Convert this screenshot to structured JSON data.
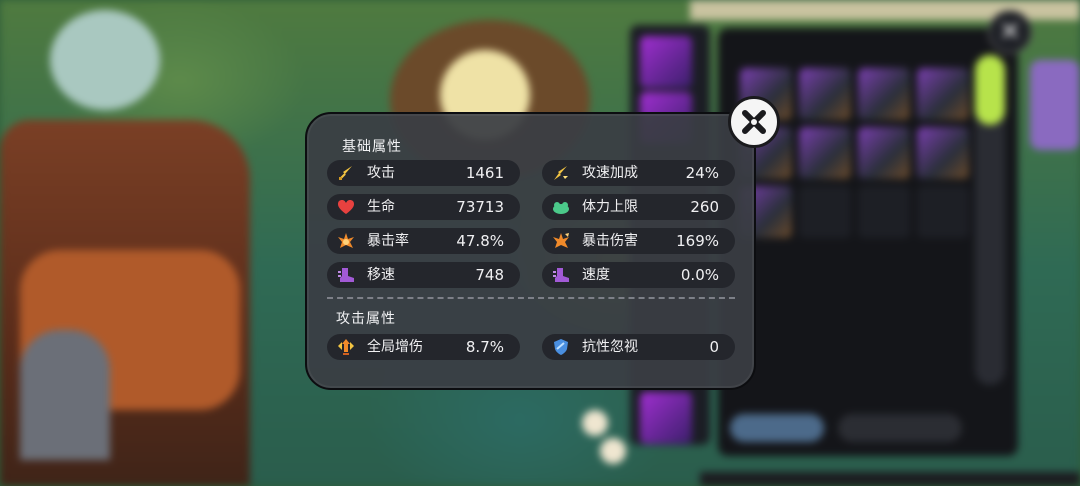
{
  "panel": {
    "basic_title": "基础属性",
    "attack_title": "攻击属性",
    "basic_stats": [
      {
        "name": "攻击",
        "value": "1461",
        "icon": "sword-icon"
      },
      {
        "name": "攻速加成",
        "value": "24%",
        "icon": "attack-speed-icon"
      },
      {
        "name": "生命",
        "value": "73713",
        "icon": "heart-icon"
      },
      {
        "name": "体力上限",
        "value": "260",
        "icon": "stamina-icon"
      },
      {
        "name": "暴击率",
        "value": "47.8%",
        "icon": "crit-rate-icon"
      },
      {
        "name": "暴击伤害",
        "value": "169%",
        "icon": "crit-damage-icon"
      },
      {
        "name": "移速",
        "value": "748",
        "icon": "boot-icon"
      },
      {
        "name": "速度",
        "value": "0.0%",
        "icon": "boot-icon"
      }
    ],
    "attack_stats": [
      {
        "name": "全局增伤",
        "value": "8.7%",
        "icon": "global-damage-icon"
      },
      {
        "name": "抗性忽视",
        "value": "0",
        "icon": "shield-icon"
      }
    ]
  },
  "colors": {
    "panel_bg": "#3a3d44",
    "row_bg": "#24262c",
    "sword": "#f4c542",
    "heart": "#e8413f",
    "stamina": "#4bc98a",
    "crit": "#f08a2a",
    "boot": "#a25ad6",
    "shield": "#4a8fe0"
  }
}
